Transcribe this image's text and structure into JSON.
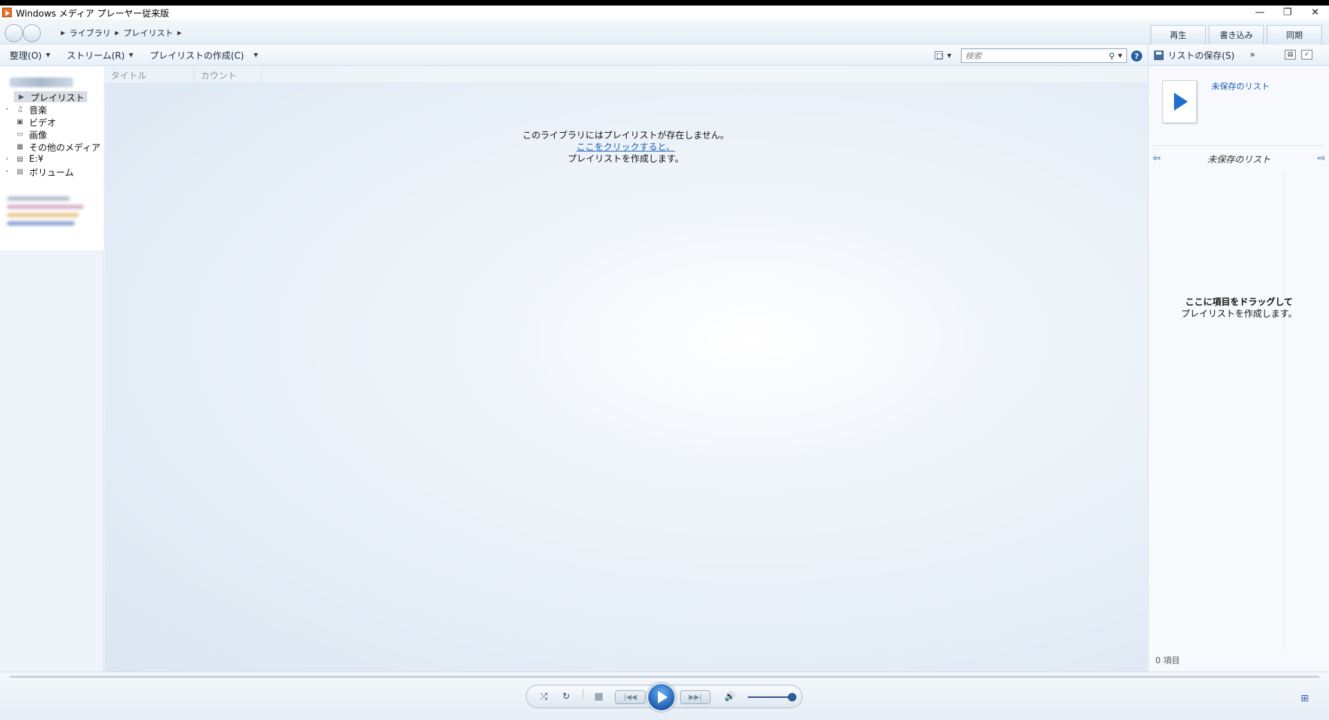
{
  "window": {
    "title": "Windows メディア プレーヤー従来版",
    "minimize": "—",
    "restore": "❐",
    "close": "✕"
  },
  "breadcrumb": [
    "ライブラリ",
    "プレイリスト"
  ],
  "tabs": [
    "再生",
    "書き込み",
    "同期"
  ],
  "toolbar": {
    "organize": "整理(O)",
    "stream": "ストリーム(R)",
    "create_playlist": "プレイリストの作成(C)"
  },
  "search": {
    "placeholder": "検索"
  },
  "right_toolbar": {
    "save_list": "リストの保存(S)",
    "more": "»"
  },
  "sidebar": {
    "items": [
      {
        "label": "プレイリスト",
        "icon": "playlist-icon",
        "selected": true
      },
      {
        "label": "音楽",
        "icon": "music-note-icon",
        "expandable": true
      },
      {
        "label": "ビデオ",
        "icon": "video-icon"
      },
      {
        "label": "画像",
        "icon": "picture-icon"
      },
      {
        "label": "その他のメディア",
        "icon": "other-media-icon"
      },
      {
        "label": "E:¥",
        "icon": "drive-icon",
        "expandable": true
      },
      {
        "label": "ボリューム",
        "icon": "drive-icon",
        "expandable": true
      }
    ]
  },
  "columns": [
    "タイトル",
    "カウント"
  ],
  "empty_library": {
    "line1": "このライブラリにはプレイリストが存在しません。",
    "link": "ここをクリックすると、",
    "line3": "プレイリストを作成します。"
  },
  "list_pane": {
    "unsaved_link": "未保存のリスト",
    "nav_title": "未保存のリスト",
    "drop_line1": "ここに項目をドラッグして",
    "drop_line2": "プレイリストを作成します。",
    "item_count": "0 項目"
  },
  "player": {
    "shuffle_icon": "shuffle-icon",
    "repeat_icon": "repeat-icon",
    "volume_level": 0.95
  },
  "colors": {
    "accent": "#1f6fd0",
    "link": "#1a5fb4",
    "background": "#eef4fa"
  }
}
